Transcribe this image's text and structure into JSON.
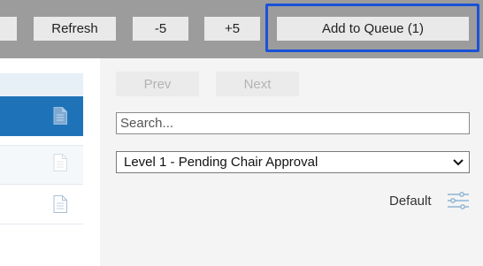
{
  "toolbar": {
    "refresh_label": "Refresh",
    "minus_label": "-5",
    "plus_label": "+5",
    "add_to_queue_label": "Add to Queue (1)"
  },
  "navigation": {
    "prev_label": "Prev",
    "next_label": "Next"
  },
  "search": {
    "placeholder": "Search..."
  },
  "filter": {
    "selected_option": "Level 1 - Pending Chair Approval"
  },
  "view": {
    "default_label": "Default"
  },
  "icons": {
    "document": "document-icon",
    "chevron": "chevron-down-icon",
    "sliders": "sliders-icon"
  },
  "colors": {
    "toolbar_bg": "#9c9c9c",
    "selection_blue": "#1e73b8",
    "focus_outline": "#1a52d8"
  }
}
